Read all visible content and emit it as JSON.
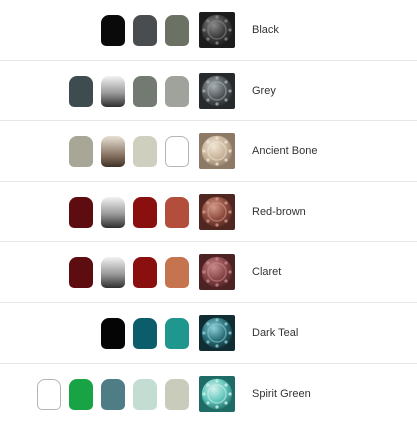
{
  "schemes": [
    {
      "label": "Black",
      "thumb": [
        "#8a8a8a",
        "#3b3b3b",
        "#1c1c1c"
      ],
      "pots": [
        "#0a0a0a",
        "#4a4d50",
        "#6b7163"
      ]
    },
    {
      "label": "Grey",
      "thumb": [
        "#a9b0b3",
        "#4f5558",
        "#262a2c"
      ],
      "pots": [
        "#3e4c50",
        "gradient-silver",
        "#727a72",
        "#9fa39c"
      ]
    },
    {
      "label": "Ancient Bone",
      "thumb": [
        "#f1e6d6",
        "#c9b39a",
        "#8d7a66"
      ],
      "pots": [
        "#a8a696",
        "gradient-bronze",
        "#cfcfc0",
        "outline"
      ]
    },
    {
      "label": "Red-brown",
      "thumb": [
        "#d49a88",
        "#8c4a3e",
        "#4f2620"
      ],
      "pots": [
        "#5d0c10",
        "gradient-silver",
        "#8a1010",
        "#b34e3c"
      ]
    },
    {
      "label": "Claret",
      "thumb": [
        "#c98a8c",
        "#874547",
        "#4c2223"
      ],
      "pots": [
        "#5d0c10",
        "gradient-silver",
        "#8a1010",
        "#c6744f"
      ]
    },
    {
      "label": "Dark Teal",
      "thumb": [
        "#8fd0d8",
        "#2a6f79",
        "#102d33"
      ],
      "pots": [
        "#050505",
        "#0b5d6b",
        "#1f968e"
      ]
    },
    {
      "label": "Spirit Green",
      "thumb": [
        "#d4f2ee",
        "#5fc5bb",
        "#1f6c66"
      ],
      "pots": [
        "outline",
        "#18a444",
        "#4e7d86",
        "#c3ddd3",
        "#c9cbbb"
      ]
    }
  ]
}
